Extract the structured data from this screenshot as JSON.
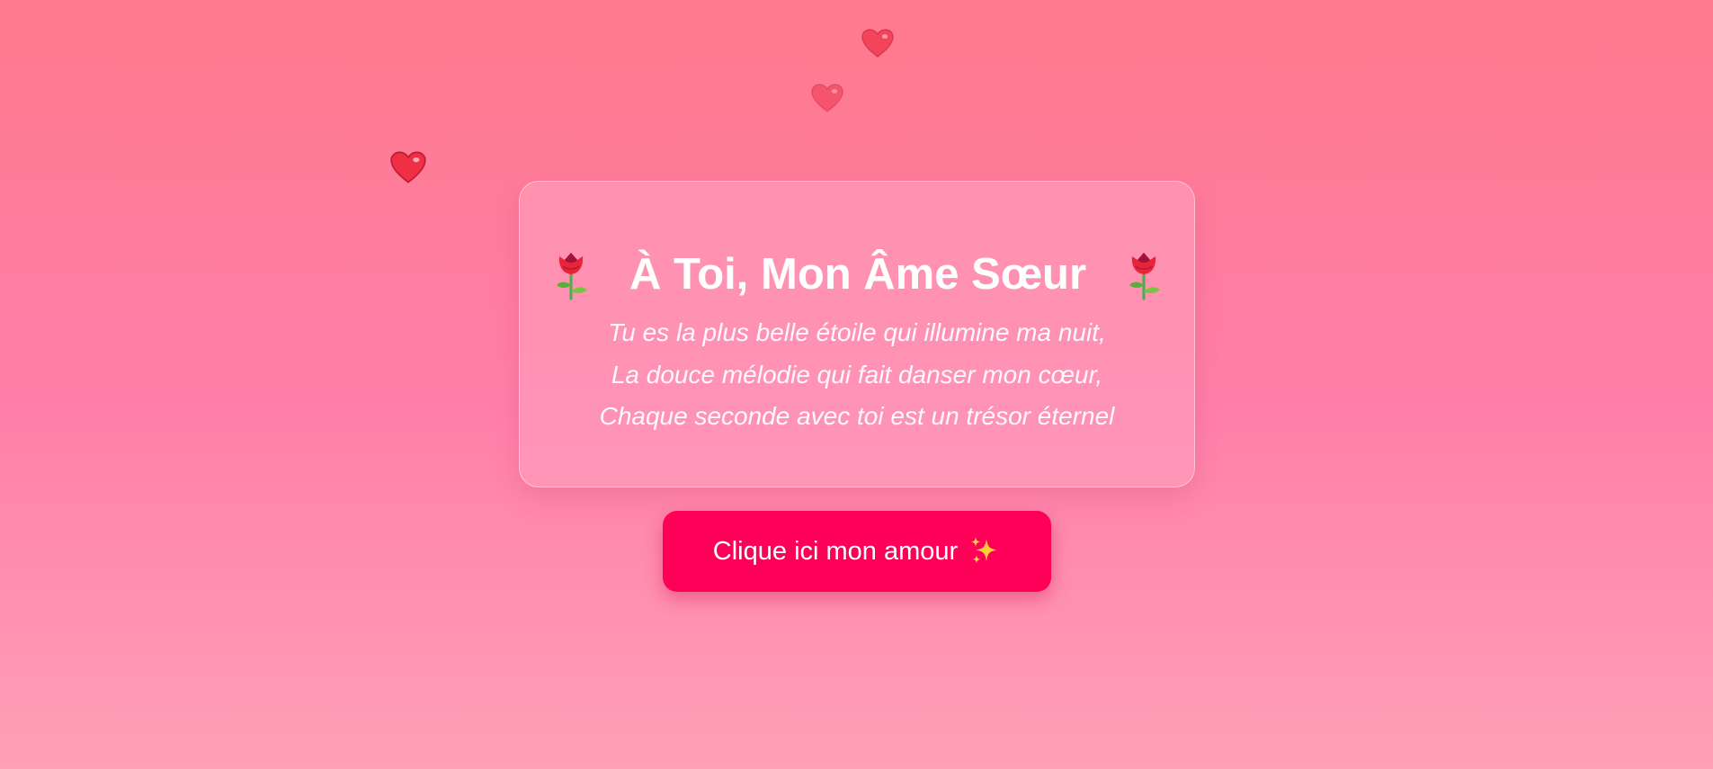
{
  "card": {
    "title": "À Toi, Mon Âme Sœur",
    "left_icon": "rose-icon",
    "right_icon": "rose-icon",
    "poem_lines": [
      "Tu es la plus belle étoile qui illumine ma nuit,",
      "La douce mélodie qui fait danser mon cœur,",
      "Chaque seconde avec toi est un trésor éternel"
    ]
  },
  "button": {
    "label": "Clique ici mon amour",
    "icon": "sparkles-icon",
    "color": "#ff0058"
  },
  "decorations": {
    "floating_hearts": [
      "heart-icon",
      "heart-icon",
      "heart-icon"
    ],
    "heart_color": "#f0364e"
  },
  "colors": {
    "background_top": "#ff7a8c",
    "background_bottom": "#ffa0b5",
    "text": "#ffffff"
  }
}
